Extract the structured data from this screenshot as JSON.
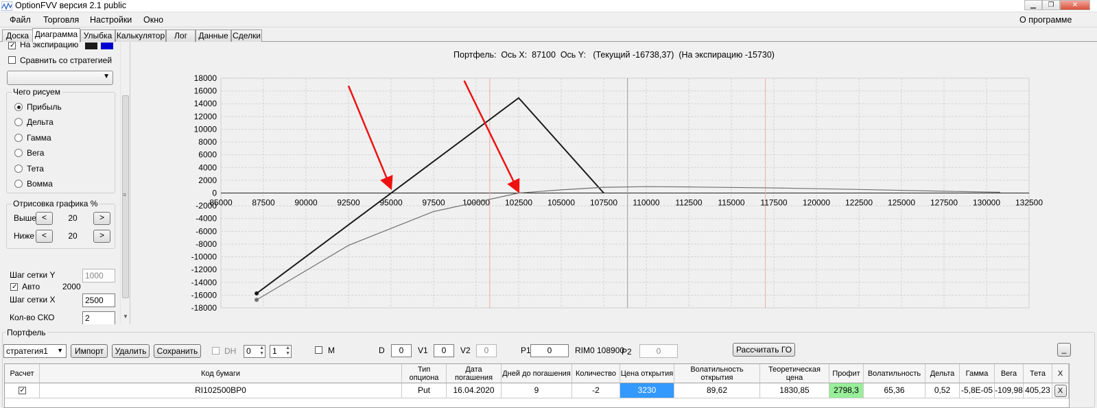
{
  "window": {
    "title": "OptionFVV версия 2.1 public",
    "controls": [
      "minimize-icon",
      "restore-icon",
      "close-icon"
    ]
  },
  "menu": {
    "items": [
      "Файл",
      "Торговля",
      "Настройки",
      "Окно"
    ],
    "about": "О программе"
  },
  "tabs": [
    "Доска",
    "Диаграмма",
    "Улыбка",
    "Калькулятор",
    "Лог",
    "Данные",
    "Сделки"
  ],
  "active_tab": "Диаграмма",
  "left": {
    "expiration_label": "На экспирацию",
    "expiration_checked": true,
    "expiration_colors": [
      "#1a1a1a",
      "#0000d0"
    ],
    "compare_label": "Сравнить со стратегией",
    "compare_checked": false,
    "strategy_select": "",
    "what_group": "Чего рисуем",
    "what_options": [
      "Прибыль",
      "Дельта",
      "Гамма",
      "Вега",
      "Тета",
      "Вомма"
    ],
    "what_selected": "Прибыль",
    "render_group": "Отрисовка графика %",
    "above_label": "Выше",
    "above_value": "20",
    "below_label": "Ниже",
    "below_value": "20",
    "grid_y_label": "Шаг сетки Y",
    "grid_y_value": "1000",
    "auto_label": "Авто",
    "auto_checked": true,
    "auto_value": "2000",
    "grid_x_label": "Шаг сетки X",
    "grid_x_value": "2500",
    "sko_label": "Кол-во СКО",
    "sko_value": "2"
  },
  "chart_header": "Портфель:  Ось X:  87100  Ось Y:   (Текущий -16738,37)  (На экспирацию -15730)",
  "chart_data": {
    "type": "line",
    "xlim": [
      85000,
      132500
    ],
    "ylim": [
      -18000,
      18000
    ],
    "x_ticks": [
      85000,
      87500,
      90000,
      92500,
      95000,
      97500,
      100000,
      102500,
      105000,
      107500,
      110000,
      112500,
      115000,
      117500,
      120000,
      122500,
      125000,
      127500,
      130000,
      132500
    ],
    "y_ticks": [
      18000,
      16000,
      14000,
      12000,
      10000,
      8000,
      6000,
      4000,
      2000,
      0,
      -2000,
      -4000,
      -6000,
      -8000,
      -10000,
      -12000,
      -14000,
      -16000,
      -18000
    ],
    "grid": true,
    "series": [
      {
        "color": "#1a1a1a",
        "x": [
          87100,
          102500,
          107500
        ],
        "y": [
          -15730,
          14900,
          0
        ]
      },
      {
        "color": "#707070",
        "x": [
          87100,
          92500,
          97500,
          102500,
          105000,
          107500,
          110000,
          112500,
          117500,
          122500,
          127500,
          130800
        ],
        "y": [
          -16738,
          -8200,
          -2900,
          0,
          500,
          900,
          1000,
          950,
          800,
          560,
          280,
          120
        ]
      }
    ],
    "markers": [
      {
        "color": "#1a1a1a",
        "x": 87100,
        "y": -15730
      },
      {
        "color": "#707070",
        "x": 87100,
        "y": -16738
      }
    ],
    "vertical_lines": [
      {
        "x": 100800,
        "color": "#f4a8a8"
      },
      {
        "x": 108900,
        "color": "#9a9a9a"
      },
      {
        "x": 117000,
        "color": "#f4a8a8"
      }
    ],
    "annotations": [
      {
        "type": "arrow",
        "color": "#ee1111",
        "from": [
          92500,
          16800
        ],
        "to": [
          95000,
          700
        ]
      },
      {
        "type": "arrow",
        "color": "#ee1111",
        "from": [
          99300,
          17600
        ],
        "to": [
          102500,
          200
        ]
      }
    ]
  },
  "portfolio": {
    "group_label": "Портфель",
    "strategy_value": "стратегия1",
    "import_btn": "Импорт",
    "delete_btn": "Удалить",
    "save_btn": "Сохранить",
    "dh_label": "DH",
    "dh_checked": false,
    "spin1": "0",
    "spin2": "1",
    "m_label": "M",
    "m_checked": false,
    "d_label": "D",
    "d_value": "0",
    "v1_label": "V1",
    "v1_value": "0",
    "v2_label": "V2",
    "v2_value": "0",
    "p1_label": "P1",
    "p1_value": "0",
    "rim_label": "RIM0 108900",
    "p2_label": "P2",
    "p2_value": "0",
    "calc_btn": "Рассчитать ГО",
    "side_btn": "_"
  },
  "table": {
    "headers": [
      "Расчет",
      "Код бумаги",
      "Тип опциона",
      "Дата погашения",
      "Дней до погашения",
      "Количество",
      "Цена открытия",
      "Волатильность открытия",
      "Теоретическая цена",
      "Профит",
      "Волатильность",
      "Дельта",
      "Гамма",
      "Вега",
      "Тета",
      "X"
    ],
    "rows": [
      {
        "calc": true,
        "code": "RI102500BP0",
        "type": "Put",
        "date": "16.04.2020",
        "days": "9",
        "qty": "-2",
        "open_price": "3230",
        "open_vol": "89,62",
        "theo": "1830,85",
        "profit": "2798,3",
        "vol": "65,36",
        "delta": "0,52",
        "gamma": "-5,8E-05",
        "vega": "-109,98",
        "theta": "405,23",
        "x": "X"
      }
    ],
    "highlight": {
      "open_price_bg": "#3399ff",
      "profit_bg": "#99ee99"
    }
  }
}
